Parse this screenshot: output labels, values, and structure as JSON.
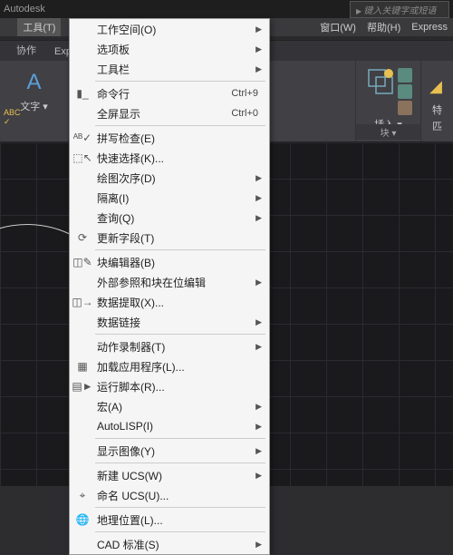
{
  "titlebar": {
    "app": "Autodesk",
    "search_placeholder": "键入关键字或短语"
  },
  "menubar": {
    "tools": "工具(T)",
    "window": "窗口(W)",
    "help": "帮助(H)",
    "express": "Express"
  },
  "ribbon_tabs": {
    "collab": "协作",
    "exp": "Exp"
  },
  "ribbon": {
    "text_panel": {
      "label": "文字",
      "btn": "文字",
      "arrow": "▾"
    },
    "insert": {
      "label": "插入",
      "arrow": "▾"
    },
    "block": {
      "label": "块 ▾"
    },
    "props": {
      "label1": "特",
      "label2": "匹"
    }
  },
  "menu": [
    {
      "label": "工作空间(O)",
      "sub": true
    },
    {
      "label": "选项板",
      "sub": true
    },
    {
      "label": "工具栏",
      "sub": true
    },
    {
      "sep": true
    },
    {
      "icon": "cmd",
      "label": "命令行",
      "shortcut": "Ctrl+9"
    },
    {
      "label": "全屏显示",
      "shortcut": "Ctrl+0"
    },
    {
      "sep": true
    },
    {
      "icon": "abc",
      "label": "拼写检查(E)"
    },
    {
      "icon": "qs",
      "label": "快速选择(K)..."
    },
    {
      "label": "绘图次序(D)",
      "sub": true
    },
    {
      "label": "隔离(I)",
      "sub": true
    },
    {
      "label": "查询(Q)",
      "sub": true
    },
    {
      "icon": "upd",
      "label": "更新字段(T)"
    },
    {
      "sep": true
    },
    {
      "icon": "blk",
      "label": "块编辑器(B)"
    },
    {
      "label": "外部参照和块在位编辑",
      "sub": true
    },
    {
      "icon": "dx",
      "label": "数据提取(X)..."
    },
    {
      "label": "数据链接",
      "sub": true
    },
    {
      "sep": true
    },
    {
      "label": "动作录制器(T)",
      "sub": true
    },
    {
      "icon": "app",
      "label": "加载应用程序(L)..."
    },
    {
      "icon": "scr",
      "label": "运行脚本(R)..."
    },
    {
      "label": "宏(A)",
      "sub": true
    },
    {
      "label": "AutoLISP(I)",
      "sub": true
    },
    {
      "sep": true
    },
    {
      "label": "显示图像(Y)",
      "sub": true
    },
    {
      "sep": true
    },
    {
      "label": "新建 UCS(W)",
      "sub": true
    },
    {
      "icon": "ucs",
      "label": "命名 UCS(U)..."
    },
    {
      "sep": true
    },
    {
      "icon": "geo",
      "label": "地理位置(L)..."
    },
    {
      "sep": true
    },
    {
      "label": "CAD 标准(S)",
      "sub": true
    }
  ]
}
